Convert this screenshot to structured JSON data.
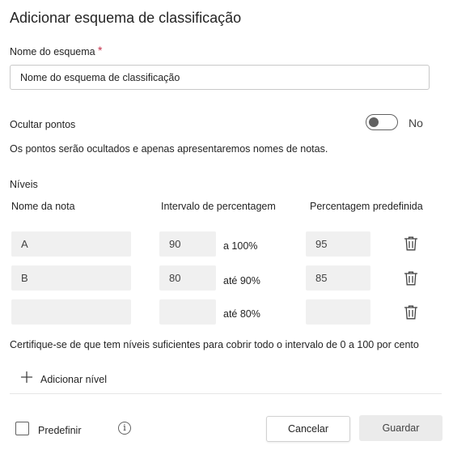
{
  "dialog": {
    "title": "Adicionar esquema de classificação"
  },
  "scheme_name": {
    "label": "Nome do esquema",
    "required_mark": "*",
    "value": "Nome do esquema de classificação"
  },
  "hide_points": {
    "label": "Ocultar pontos",
    "state": "No",
    "enabled": false,
    "description": "Os pontos serão ocultados e apenas apresentaremos nomes de notas."
  },
  "levels": {
    "section_label": "Níveis",
    "headers": {
      "grade_name": "Nome da nota",
      "range": "Intervalo de percentagem",
      "default_pct": "Percentagem predefinida"
    },
    "rows": [
      {
        "name": "A",
        "min": "90",
        "range_suffix": "a 100%",
        "default": "95"
      },
      {
        "name": "B",
        "min": "80",
        "range_suffix": "até 90%",
        "default": "85"
      },
      {
        "name": "",
        "min": "",
        "range_suffix": "até 80%",
        "default": ""
      }
    ],
    "hint": "Certifique-se de que tem níveis suficientes para cobrir todo o intervalo de 0 a 100 por cento",
    "add_label": "Adicionar nível"
  },
  "footer": {
    "default_label": "Predefinir",
    "info_glyph": "i",
    "cancel_label": "Cancelar",
    "save_label": "Guardar"
  },
  "icons": {
    "delete": "trash-icon",
    "add": "plus-icon",
    "info": "info-icon"
  },
  "colors": {
    "required": "#c4314b",
    "field_bg": "#f0f0f0",
    "save_bg": "#ebebeb"
  }
}
